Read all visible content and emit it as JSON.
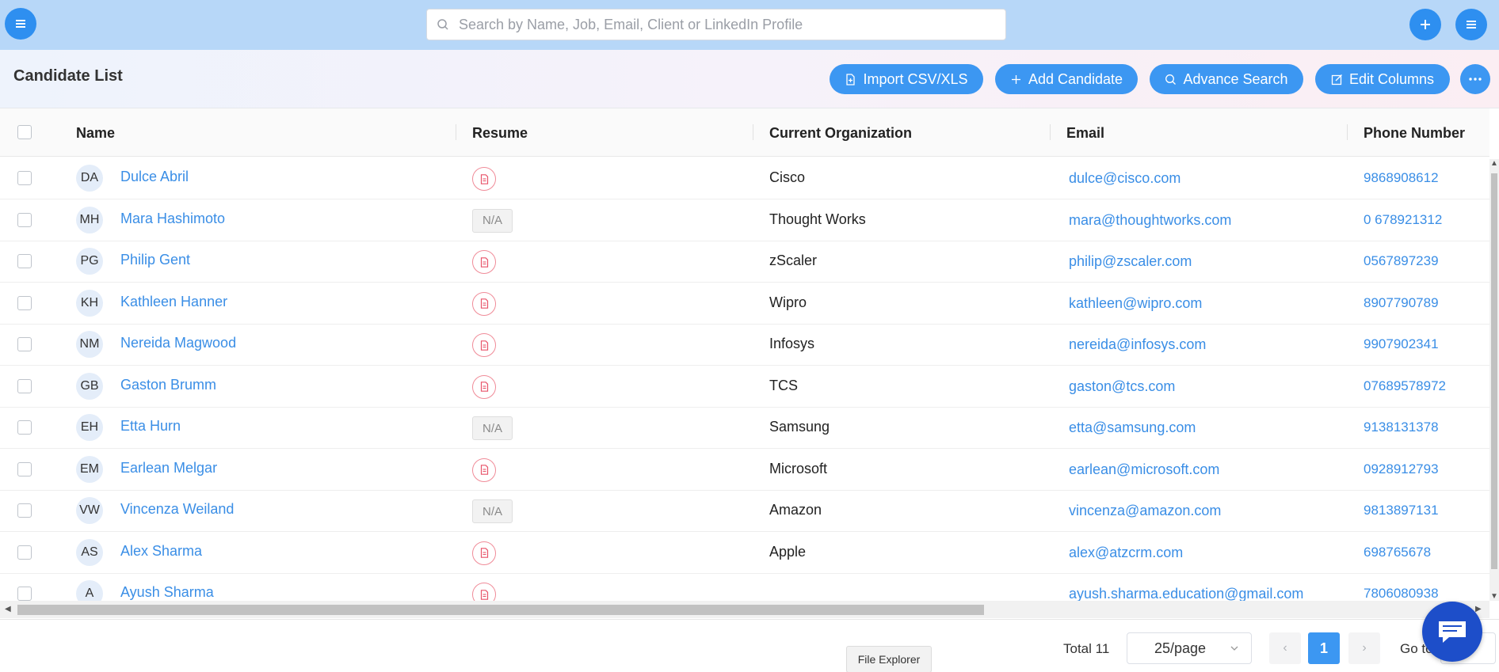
{
  "topbar": {
    "search_placeholder": "Search by Name, Job, Email, Client or LinkedIn Profile",
    "accent": "#2e8ff0"
  },
  "header": {
    "title": "Candidate List",
    "import_label": "Import CSV/XLS",
    "add_label": "Add Candidate",
    "advance_label": "Advance Search",
    "edit_columns_label": "Edit Columns"
  },
  "table": {
    "columns": [
      "Name",
      "Resume",
      "Current Organization",
      "Email",
      "Phone Number"
    ],
    "rows": [
      {
        "initials": "DA",
        "name": "Dulce Abril",
        "resume": "file",
        "org": "Cisco",
        "email": "dulce@cisco.com",
        "phone": "9868908612"
      },
      {
        "initials": "MH",
        "name": "Mara Hashimoto",
        "resume": "N/A",
        "org": "Thought Works",
        "email": "mara@thoughtworks.com",
        "phone": "0 678921312"
      },
      {
        "initials": "PG",
        "name": "Philip Gent",
        "resume": "file",
        "org": "zScaler",
        "email": "philip@zscaler.com",
        "phone": "0567897239"
      },
      {
        "initials": "KH",
        "name": "Kathleen Hanner",
        "resume": "file",
        "org": "Wipro",
        "email": "kathleen@wipro.com",
        "phone": "8907790789"
      },
      {
        "initials": "NM",
        "name": "Nereida Magwood",
        "resume": "file",
        "org": "Infosys",
        "email": "nereida@infosys.com",
        "phone": "9907902341"
      },
      {
        "initials": "GB",
        "name": "Gaston Brumm",
        "resume": "file",
        "org": "TCS",
        "email": "gaston@tcs.com",
        "phone": "07689578972"
      },
      {
        "initials": "EH",
        "name": "Etta Hurn",
        "resume": "N/A",
        "org": "Samsung",
        "email": "etta@samsung.com",
        "phone": "9138131378"
      },
      {
        "initials": "EM",
        "name": "Earlean Melgar",
        "resume": "file",
        "org": "Microsoft",
        "email": "earlean@microsoft.com",
        "phone": "0928912793"
      },
      {
        "initials": "VW",
        "name": "Vincenza Weiland",
        "resume": "N/A",
        "org": "Amazon",
        "email": "vincenza@amazon.com",
        "phone": "9813897131"
      },
      {
        "initials": "AS",
        "name": "Alex Sharma",
        "resume": "file",
        "org": "Apple",
        "email": "alex@atzcrm.com",
        "phone": "698765678"
      },
      {
        "initials": "A",
        "name": "Ayush Sharma",
        "resume": "file",
        "org": "",
        "email": "ayush.sharma.education@gmail.com",
        "phone": "7806080938"
      }
    ]
  },
  "footer": {
    "file_explorer": "File Explorer",
    "total": "Total 11",
    "page_size": "25/page",
    "current_page": "1",
    "goto_label": "Go to"
  }
}
